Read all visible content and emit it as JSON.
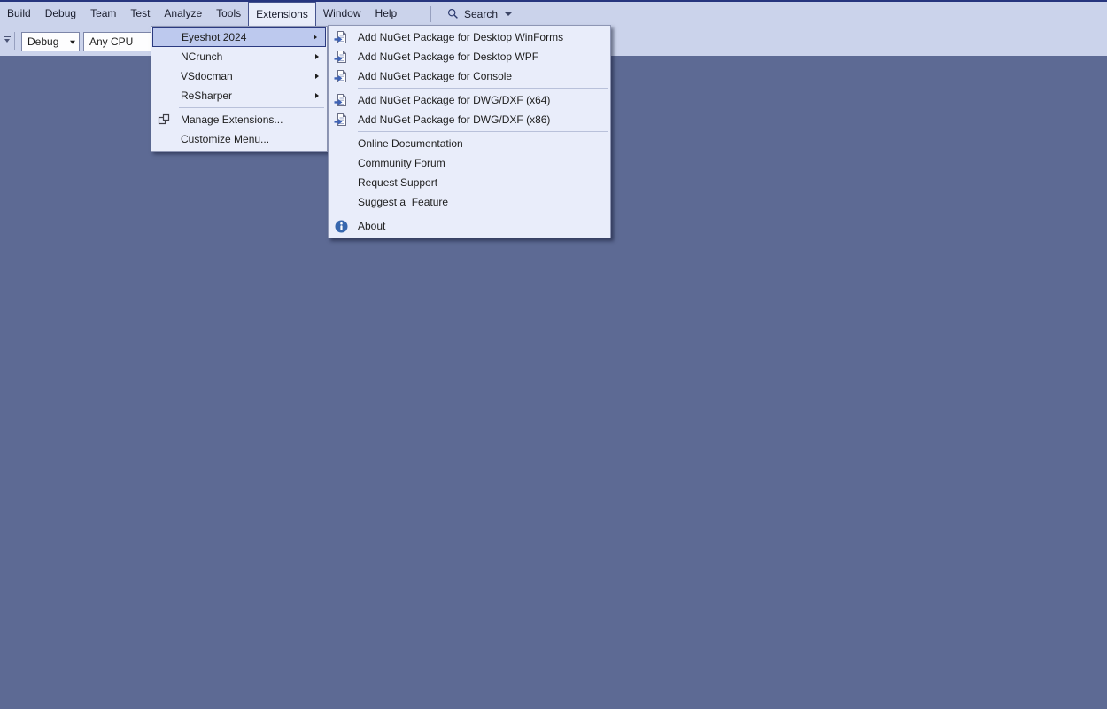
{
  "colors": {
    "title_accent": "#26357e",
    "band_background": "#cbd3eb",
    "workspace_background": "#5d6a94",
    "menu_background": "#e9edfa",
    "menu_highlight_bg": "#bdc9ee",
    "menu_highlight_border": "#2b3a80",
    "info_icon_blue": "#3767ae",
    "nuget_arrow_blue": "#3e62b5"
  },
  "menubar": {
    "items": [
      "Build",
      "Debug",
      "Team",
      "Test",
      "Analyze",
      "Tools",
      "Extensions",
      "Window",
      "Help"
    ],
    "active_item": "Extensions",
    "search": {
      "label": "Search"
    }
  },
  "toolbar": {
    "config_value": "Debug",
    "platform_value": "Any CPU"
  },
  "extensions_menu": {
    "items": [
      {
        "label": "Eyeshot 2024",
        "has_submenu": true,
        "highlighted": true
      },
      {
        "label": "NCrunch",
        "has_submenu": true
      },
      {
        "label": "VSdocman",
        "has_submenu": true
      },
      {
        "label": "ReSharper",
        "has_submenu": true
      },
      {
        "label": "Manage Extensions...",
        "icon": "manage-extensions-icon"
      },
      {
        "label": "Customize Menu..."
      }
    ]
  },
  "eyeshot_submenu": {
    "items": [
      {
        "label": "Add NuGet Package for Desktop WinForms",
        "icon": "nuget-package-icon"
      },
      {
        "label": "Add NuGet Package for Desktop WPF",
        "icon": "nuget-package-icon"
      },
      {
        "label": "Add NuGet Package for Console",
        "icon": "nuget-package-icon"
      },
      {
        "label": "Add NuGet Package for DWG/DXF (x64)",
        "icon": "nuget-package-icon"
      },
      {
        "label": "Add NuGet Package for DWG/DXF (x86)",
        "icon": "nuget-package-icon"
      },
      {
        "label": "Online Documentation"
      },
      {
        "label": "Community Forum"
      },
      {
        "label": "Request Support"
      },
      {
        "label": "Suggest a  Feature"
      },
      {
        "label": "About",
        "icon": "info-icon"
      }
    ]
  }
}
